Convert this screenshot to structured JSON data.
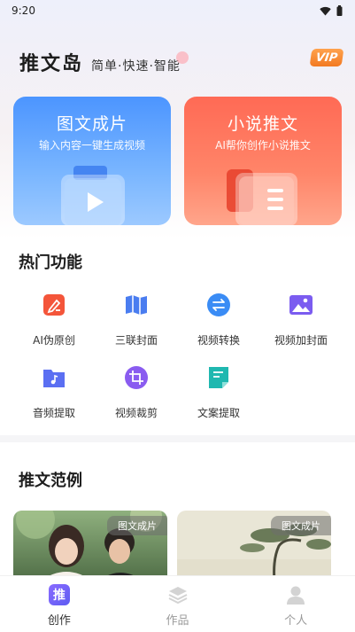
{
  "status_bar": {
    "time": "9:20"
  },
  "header": {
    "app_name": "推文岛",
    "slogan": "简单·快速·智能",
    "vip_label": "VIP"
  },
  "hero_cards": [
    {
      "title": "图文成片",
      "subtitle": "输入内容一键生成视频",
      "color": "#4c95ff"
    },
    {
      "title": "小说推文",
      "subtitle": "AI帮你创作小说推文",
      "color": "#ff6a55"
    }
  ],
  "hot_features": {
    "title": "热门功能",
    "items": [
      {
        "label": "AI伪原创",
        "icon": "ai-rewrite-icon",
        "color": "#f4553a"
      },
      {
        "label": "三联封面",
        "icon": "map-icon",
        "color": "#4a7df0"
      },
      {
        "label": "视频转换",
        "icon": "convert-icon",
        "color": "#3a8cf5"
      },
      {
        "label": "视频加封面",
        "icon": "image-icon",
        "color": "#7b5cf0"
      },
      {
        "label": "音频提取",
        "icon": "music-folder-icon",
        "color": "#5b6ff2"
      },
      {
        "label": "视频裁剪",
        "icon": "crop-icon",
        "color": "#8a5cf0"
      },
      {
        "label": "文案提取",
        "icon": "document-icon",
        "color": "#1fb8b0"
      }
    ]
  },
  "examples": {
    "title": "推文范例",
    "items": [
      {
        "tag": "图文成片"
      },
      {
        "tag": "图文成片"
      }
    ]
  },
  "bottom_nav": [
    {
      "label": "创作",
      "icon_text": "推",
      "active": true
    },
    {
      "label": "作品",
      "active": false
    },
    {
      "label": "个人",
      "active": false
    }
  ]
}
